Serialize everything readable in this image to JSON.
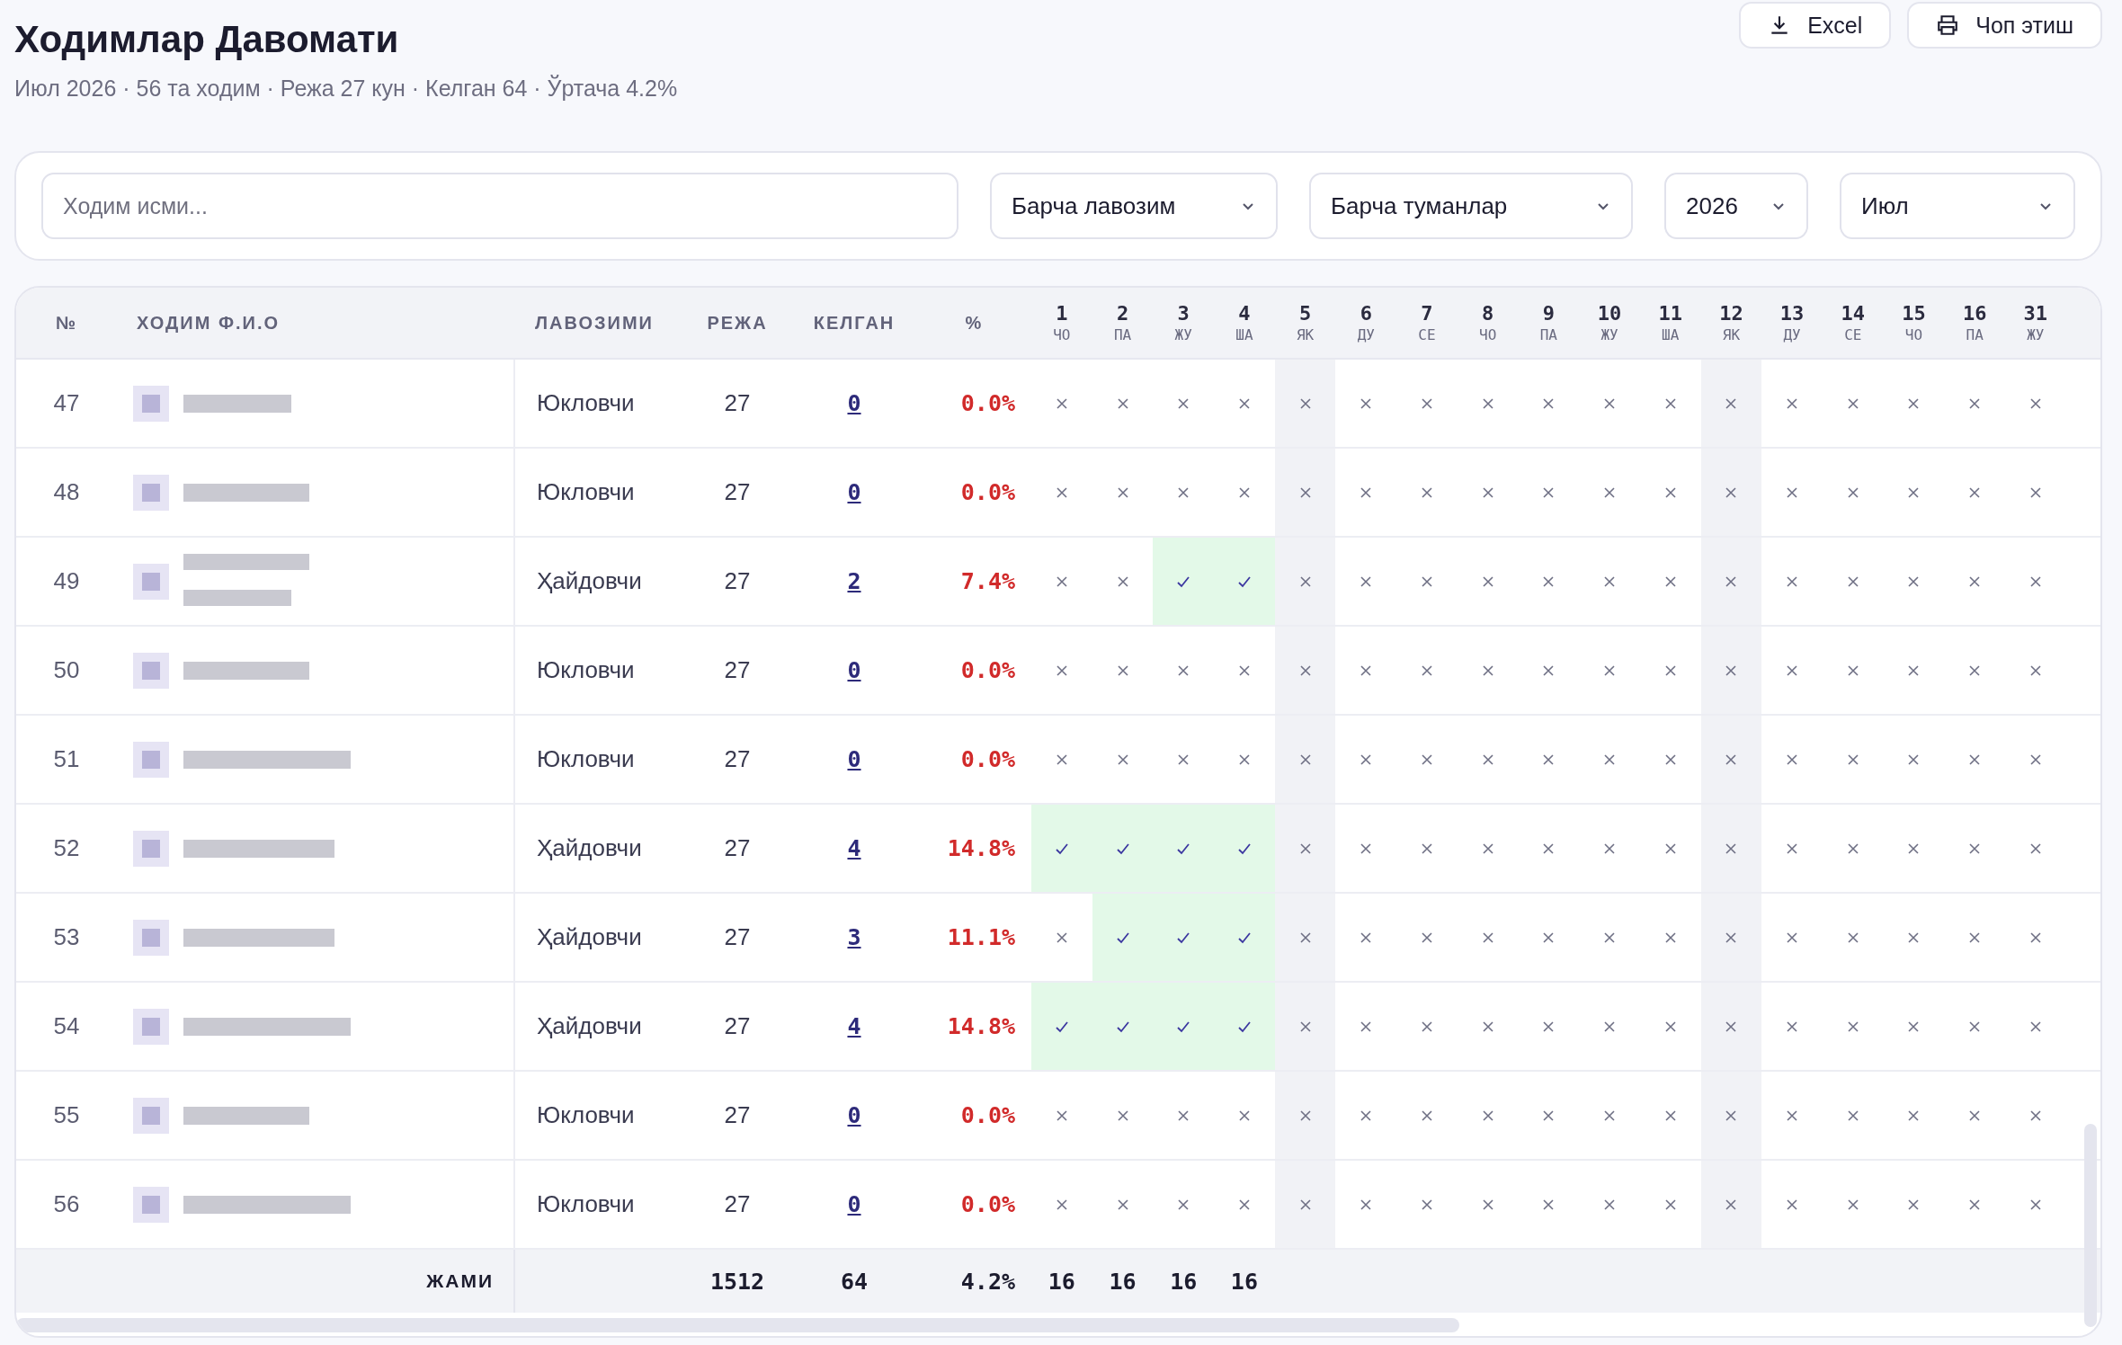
{
  "page": {
    "title": "Ходимлар Давомати",
    "subtitle": "Июл 2026 · 56 та ходим · Режа 27 кун · Келган 64 · Ўртача 4.2%"
  },
  "actions": [
    {
      "label": "Excel",
      "kind": "download"
    },
    {
      "label": "Чоп этиш",
      "kind": "print"
    }
  ],
  "filters": {
    "search": {
      "placeholder": "Ходим исми..."
    },
    "selects": [
      "Барча лавозим",
      "Барча туманлар",
      "2026",
      "Июл"
    ]
  },
  "table": {
    "columns": [
      "№",
      "ХОДИМ Ф.И.О",
      "ЛАВОЗИМИ",
      "РЕЖА",
      "КЕЛГАН",
      "%"
    ],
    "days": [
      {
        "day": "1",
        "weekday": "ЧО",
        "weekend": false
      },
      {
        "day": "2",
        "weekday": "ПА",
        "weekend": false
      },
      {
        "day": "3",
        "weekday": "ЖУ",
        "weekend": false
      },
      {
        "day": "4",
        "weekday": "ША",
        "weekend": false
      },
      {
        "day": "5",
        "weekday": "ЯК",
        "weekend": true
      },
      {
        "day": "6",
        "weekday": "ДУ",
        "weekend": false
      },
      {
        "day": "7",
        "weekday": "СЕ",
        "weekend": false
      },
      {
        "day": "8",
        "weekday": "ЧО",
        "weekend": false
      },
      {
        "day": "9",
        "weekday": "ПА",
        "weekend": false
      },
      {
        "day": "10",
        "weekday": "ЖУ",
        "weekend": false
      },
      {
        "day": "11",
        "weekday": "ША",
        "weekend": false
      },
      {
        "day": "12",
        "weekday": "ЯК",
        "weekend": true
      },
      {
        "day": "13",
        "weekday": "ДУ",
        "weekend": false
      },
      {
        "day": "14",
        "weekday": "СЕ",
        "weekend": false
      },
      {
        "day": "15",
        "weekday": "ЧО",
        "weekend": false
      },
      {
        "day": "16",
        "weekday": "ПА",
        "weekend": false
      },
      {
        "day": "31",
        "weekday": "ЖУ",
        "weekend": false
      }
    ],
    "rows": [
      {
        "no": "47",
        "position": "Юкловчи",
        "plan": "27",
        "attended": "0",
        "percent": "0.0%",
        "attendance": [
          false,
          false,
          false,
          false,
          false,
          false,
          false,
          false,
          false,
          false,
          false,
          false,
          false,
          false,
          false,
          false,
          false
        ]
      },
      {
        "no": "48",
        "position": "Юкловчи",
        "plan": "27",
        "attended": "0",
        "percent": "0.0%",
        "attendance": [
          false,
          false,
          false,
          false,
          false,
          false,
          false,
          false,
          false,
          false,
          false,
          false,
          false,
          false,
          false,
          false,
          false
        ]
      },
      {
        "no": "49",
        "position": "Ҳайдовчи",
        "plan": "27",
        "attended": "2",
        "percent": "7.4%",
        "attendance": [
          false,
          false,
          true,
          true,
          false,
          false,
          false,
          false,
          false,
          false,
          false,
          false,
          false,
          false,
          false,
          false,
          false
        ]
      },
      {
        "no": "50",
        "position": "Юкловчи",
        "plan": "27",
        "attended": "0",
        "percent": "0.0%",
        "attendance": [
          false,
          false,
          false,
          false,
          false,
          false,
          false,
          false,
          false,
          false,
          false,
          false,
          false,
          false,
          false,
          false,
          false
        ]
      },
      {
        "no": "51",
        "position": "Юкловчи",
        "plan": "27",
        "attended": "0",
        "percent": "0.0%",
        "attendance": [
          false,
          false,
          false,
          false,
          false,
          false,
          false,
          false,
          false,
          false,
          false,
          false,
          false,
          false,
          false,
          false,
          false
        ]
      },
      {
        "no": "52",
        "position": "Ҳайдовчи",
        "plan": "27",
        "attended": "4",
        "percent": "14.8%",
        "attendance": [
          true,
          true,
          true,
          true,
          false,
          false,
          false,
          false,
          false,
          false,
          false,
          false,
          false,
          false,
          false,
          false,
          false
        ]
      },
      {
        "no": "53",
        "position": "Ҳайдовчи",
        "plan": "27",
        "attended": "3",
        "percent": "11.1%",
        "attendance": [
          false,
          true,
          true,
          true,
          false,
          false,
          false,
          false,
          false,
          false,
          false,
          false,
          false,
          false,
          false,
          false,
          false
        ]
      },
      {
        "no": "54",
        "position": "Ҳайдовчи",
        "plan": "27",
        "attended": "4",
        "percent": "14.8%",
        "attendance": [
          true,
          true,
          true,
          true,
          false,
          false,
          false,
          false,
          false,
          false,
          false,
          false,
          false,
          false,
          false,
          false,
          false
        ]
      },
      {
        "no": "55",
        "position": "Юкловчи",
        "plan": "27",
        "attended": "0",
        "percent": "0.0%",
        "attendance": [
          false,
          false,
          false,
          false,
          false,
          false,
          false,
          false,
          false,
          false,
          false,
          false,
          false,
          false,
          false,
          false,
          false
        ]
      },
      {
        "no": "56",
        "position": "Юкловчи",
        "plan": "27",
        "attended": "0",
        "percent": "0.0%",
        "attendance": [
          false,
          false,
          false,
          false,
          false,
          false,
          false,
          false,
          false,
          false,
          false,
          false,
          false,
          false,
          false,
          false,
          false
        ]
      }
    ],
    "totals": {
      "label": "ЖАМИ",
      "plan": "1512",
      "attended": "64",
      "percent": "4.2%",
      "days": [
        "16",
        "16",
        "16",
        "16"
      ]
    }
  }
}
